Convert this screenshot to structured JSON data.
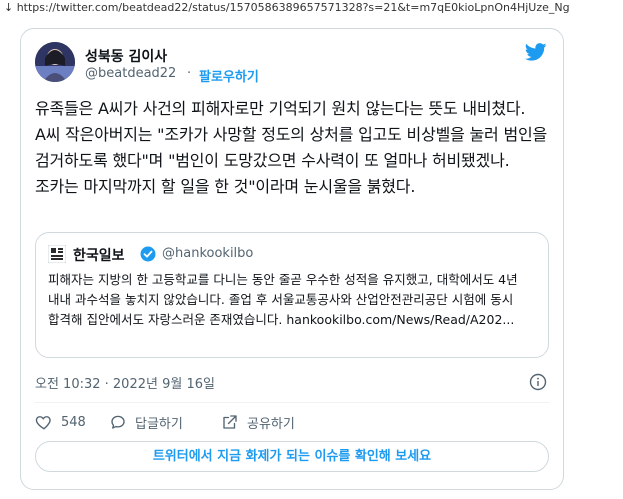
{
  "browser": {
    "url_line": "↓ https://twitter.com/beatdead22/status/1570586389657571328?s=21&t=m7qE0kioLpnOn4HjUze_Ng"
  },
  "tweet": {
    "author_name": "성북동 김이사",
    "author_handle": "@beatdead22",
    "separator": "·",
    "follow_label": "팔로우하기",
    "text": "유족들은 A씨가 사건의 피해자로만 기억되기 원치 않는다는 뜻도 내비쳤다. A씨 작은아버지는 \"조카가 사망할 정도의 상처를 입고도 비상벨을 눌러 범인을 검거하도록 했다\"며 \"범인이 도망갔으면 수사력이 또 얼마나 허비됐겠나. 조카는 마지막까지 할 일을 한 것\"이라며 눈시울을 붉혔다.",
    "quoted": {
      "name": "한국일보",
      "handle": "@hankookilbo",
      "text": "피해자는 지방의 한 고등학교를 다니는 동안 줄곧 우수한 성적을 유지했고, 대학에서도 4년 내내 과수석을 놓치지 않았습니다. 졸업 후 서울교통공사와 산업안전관리공단 시험에 동시 합격해 집안에서도 자랑스러운 존재였습니다. hankookilbo.com/News/Read/A202..."
    },
    "timestamp": "오전 10:32 · 2022년 9월 16일",
    "actions": {
      "like_count": "548",
      "reply_label": "답글하기",
      "share_label": "공유하기"
    },
    "cta_label": "트위터에서 지금 화제가 되는 이슈를 확인해 보세요",
    "icons": {
      "brand": "twitter-bird-icon",
      "like": "heart-icon",
      "reply": "reply-icon",
      "share": "share-icon",
      "info": "info-icon",
      "verified": "verified-badge-icon"
    },
    "colors": {
      "accent": "#1d9bf0",
      "text": "#0f1419",
      "secondary": "#536471",
      "border": "#cfd9de"
    }
  }
}
